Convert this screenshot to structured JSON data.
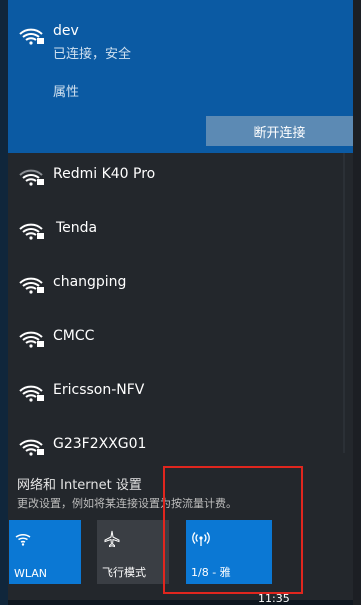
{
  "connected": {
    "name": "dev",
    "status": "已连接，安全",
    "properties_label": "属性",
    "disconnect_label": "断开连接"
  },
  "networks": [
    {
      "name": "Redmi K40 Pro",
      "icon": "wifi-secured-icon"
    },
    {
      "name": "Tenda",
      "icon": "wifi-secured-icon"
    },
    {
      "name": "changping",
      "icon": "wifi-secured-icon"
    },
    {
      "name": "CMCC",
      "icon": "wifi-secured-icon"
    },
    {
      "name": "Ericsson-NFV",
      "icon": "wifi-secured-icon"
    },
    {
      "name": "G23F2XXG01",
      "icon": "wifi-secured-icon"
    }
  ],
  "settings": {
    "title": "网络和 Internet 设置",
    "description": "更改设置，例如将某连接设置为按流量计费。"
  },
  "tiles": [
    {
      "label": "WLAN",
      "state": "on",
      "icon": "wifi-icon"
    },
    {
      "label": "飞行模式",
      "state": "off",
      "icon": "airplane-icon"
    },
    {
      "label": "1/8 - 雅",
      "state": "on",
      "icon": "mobile-hotspot-icon"
    }
  ],
  "taskbar": {
    "time": "11:35"
  },
  "colors": {
    "accent": "#0b78d4",
    "connected_bg": "#0b5aa3",
    "highlight": "#e0261e"
  }
}
